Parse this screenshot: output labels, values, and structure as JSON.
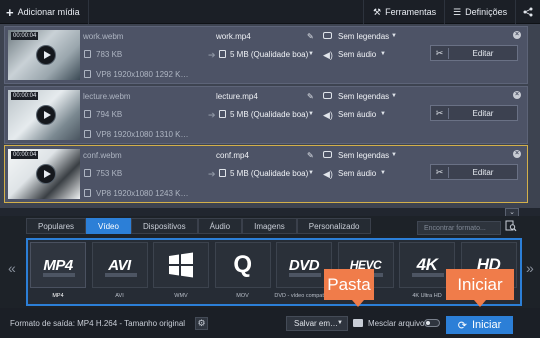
{
  "toolbar": {
    "add_media": "Adicionar mídia",
    "tools": "Ferramentas",
    "settings": "Definições"
  },
  "files": [
    {
      "time": "00:00:04",
      "source_name": "work.webm",
      "source_size": "783 KB",
      "source_info": "VP8 1920x1080 1292 K…",
      "output_name": "work.mp4",
      "output_size": "5 MB (Qualidade boa)",
      "subtitles": "Sem legendas",
      "audio": "Sem áudio",
      "edit": "Editar",
      "active": false
    },
    {
      "time": "00:00:04",
      "source_name": "lecture.webm",
      "source_size": "794 KB",
      "source_info": "VP8 1920x1080 1310 K…",
      "output_name": "lecture.mp4",
      "output_size": "5 MB (Qualidade boa)",
      "subtitles": "Sem legendas",
      "audio": "Sem áudio",
      "edit": "Editar",
      "active": false
    },
    {
      "time": "00:00:04",
      "source_name": "conf.webm",
      "source_size": "753 KB",
      "source_info": "VP8 1920x1080 1243 K…",
      "output_name": "conf.mp4",
      "output_size": "5 MB (Qualidade boa)",
      "subtitles": "Sem legendas",
      "audio": "Sem áudio",
      "edit": "Editar",
      "active": true
    }
  ],
  "tabs": [
    {
      "label": "Populares",
      "active": false
    },
    {
      "label": "Vídeo",
      "active": true
    },
    {
      "label": "Dispositivos",
      "active": false
    },
    {
      "label": "Áudio",
      "active": false
    },
    {
      "label": "Imagens",
      "active": false
    },
    {
      "label": "Personalizado",
      "active": false
    }
  ],
  "search": {
    "placeholder": "Encontrar formato..."
  },
  "formats": [
    {
      "tile": "MP4",
      "label": "MP4",
      "active": true
    },
    {
      "tile": "AVI",
      "label": "AVI",
      "active": false
    },
    {
      "tile": "WMV",
      "label": "WMV",
      "active": false,
      "icon": "windows-logo-icon"
    },
    {
      "tile": "Q",
      "label": "MOV",
      "active": false,
      "icon": "quicktime-logo-icon"
    },
    {
      "tile": "DVD",
      "label": "DVD - vídeo compatív…",
      "active": false
    },
    {
      "tile": "HEVC",
      "label": "HEVC",
      "active": false
    },
    {
      "tile": "4K",
      "label": "4K Ultra HD",
      "active": false
    },
    {
      "tile": "HD",
      "label": "HD",
      "active": false
    }
  ],
  "bottom": {
    "output_format": "Formato de saída: MP4 H.264 - Tamanho original",
    "save_to": "Salvar em…",
    "merge": "Mesclar arquivos",
    "start": "Iniciar"
  },
  "callouts": {
    "folder": "Pasta",
    "start": "Iniciar"
  },
  "colors": {
    "accent": "#2c7fd7",
    "callout": "#f07c4a",
    "active_border": "#d3b04a"
  }
}
